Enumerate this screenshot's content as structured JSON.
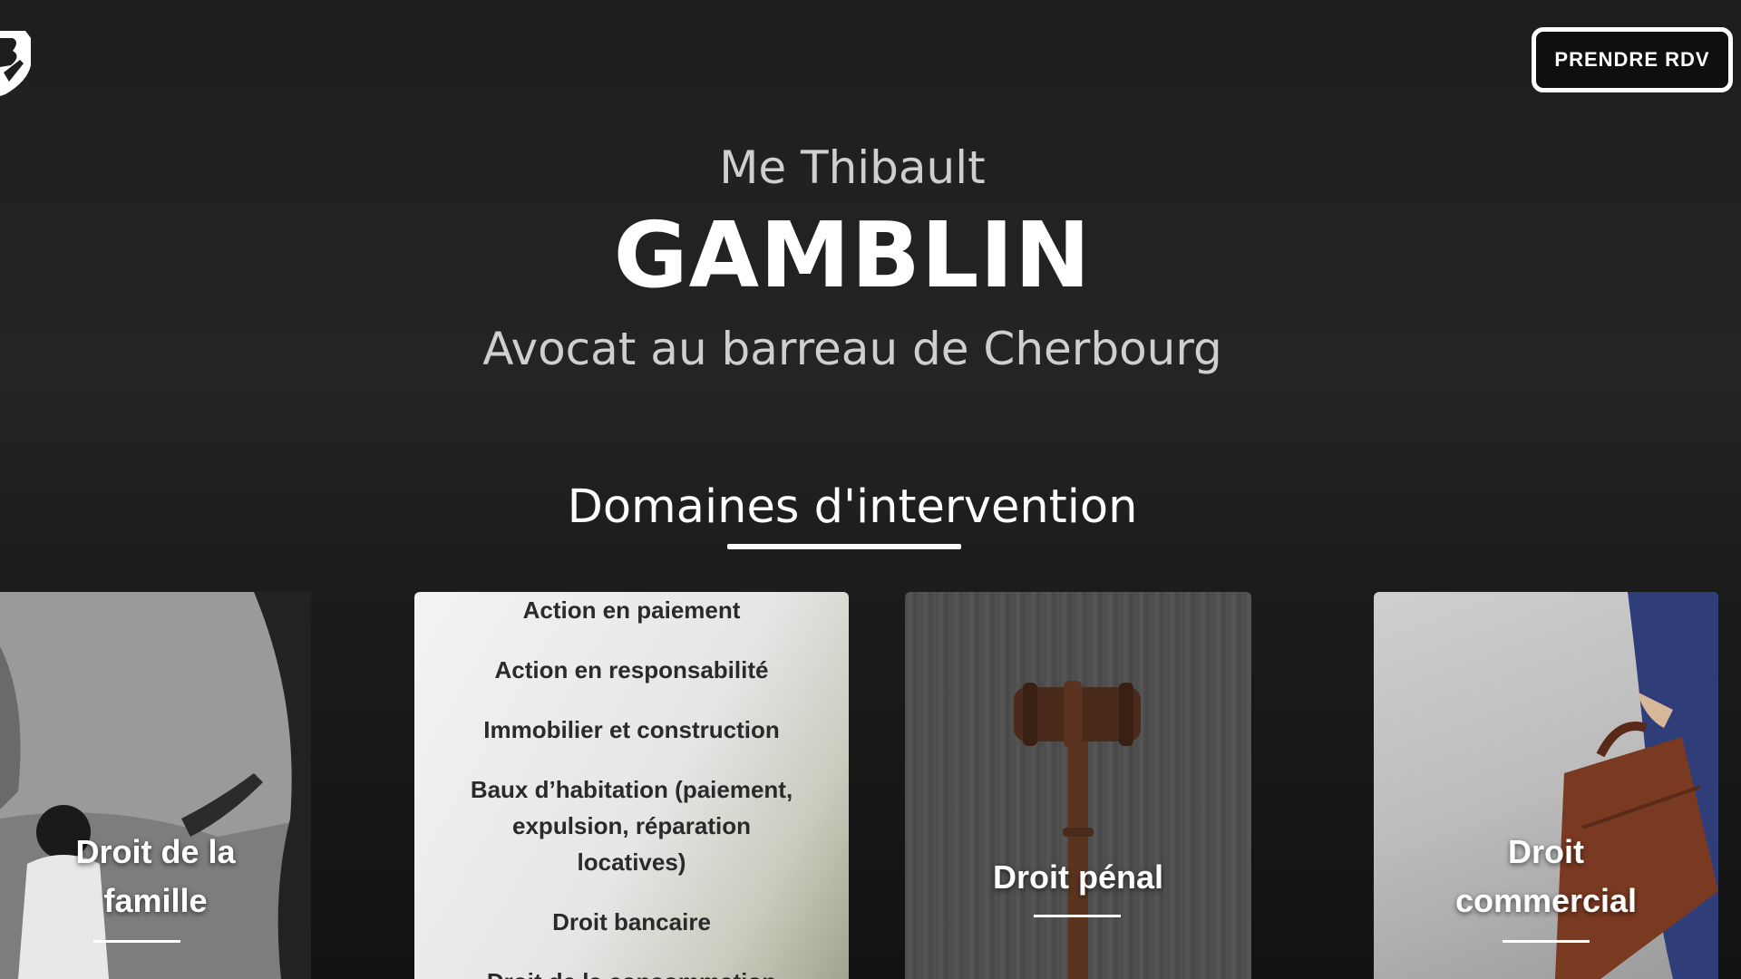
{
  "header": {
    "logo_icon": "shield-logo-icon",
    "cta_label": "PRENDRE RDV"
  },
  "hero": {
    "pre_title": "Me Thibault",
    "name": "GAMBLIN",
    "subtitle": "Avocat au barreau de Cherbourg"
  },
  "section": {
    "title": "Domaines d'intervention"
  },
  "cards": {
    "famille": {
      "label": "Droit de la famille"
    },
    "list": {
      "items": [
        "Action en paiement",
        "Action en responsabilité",
        "Immobilier et construction",
        "Baux d’habitation (paiement, expulsion, réparation locatives)",
        "Droit bancaire",
        "Droit de la consommation"
      ]
    },
    "penal": {
      "label": "Droit pénal"
    },
    "commercial": {
      "label": "Droit commercial"
    }
  },
  "colors": {
    "background": "#1e1e1e",
    "text": "#ffffff",
    "muted_text": "#cfcfcf",
    "list_text": "#2a2a2a"
  }
}
